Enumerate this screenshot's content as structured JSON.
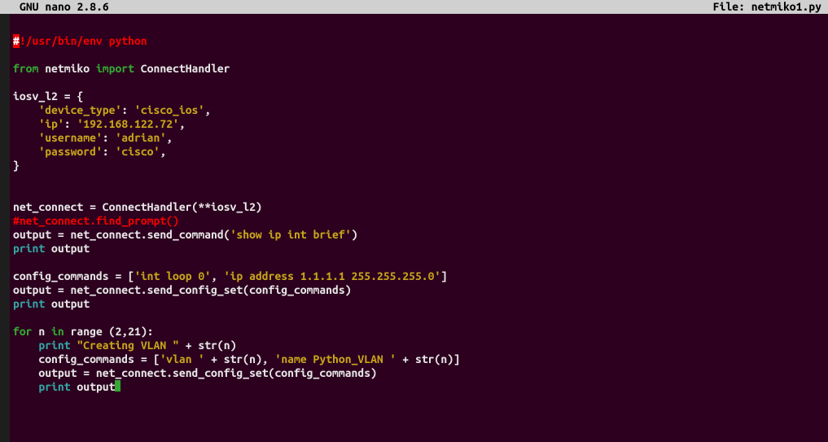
{
  "titlebar": {
    "app": "GNU nano 2.8.6",
    "file_label": "File: ",
    "filename": "netmiko1.py"
  },
  "code": {
    "shebang_hash": "#",
    "shebang_rest": "!/usr/bin/env python",
    "l_from": "from",
    "l_netmiko": " netmiko ",
    "l_import": "import",
    "l_connecthandler": " ConnectHandler",
    "var_iosv": "iosv_l2 = {",
    "k_devtype": "'device_type'",
    "v_devtype": "'cisco_ios'",
    "k_ip": "'ip'",
    "v_ip": "'192.168.122.72'",
    "k_user": "'username'",
    "v_user": "'adrian'",
    "k_pass": "'password'",
    "v_pass": "'cisco'",
    "close_brace": "}",
    "net_connect_line": "net_connect = ConnectHandler(**iosv_l2)",
    "comment_findprompt": "#net_connect.find_prompt()",
    "output_eq": "output = net_connect.send_command(",
    "str_showip": "'show ip int brief'",
    "close_paren": ")",
    "kw_print": "print",
    "sp_output": " output",
    "cfg_cmds_eq": "config_commands = [",
    "str_intloop": "'int loop 0'",
    "comma_sp": ", ",
    "str_ipaddr": "'ip address 1.1.1.1 255.255.255.0'",
    "close_bracket": "]",
    "output_sendcfg": "output = net_connect.send_config_set(config_commands)",
    "kw_for": "for",
    "for_n": " n ",
    "kw_in": "in",
    "sp_range": " range (2,21):",
    "indent": "    ",
    "str_creating": "\"Creating VLAN \"",
    "plus_strn": " + str(n)",
    "cfg_cmds_eq2": "config_commands = [",
    "str_vlan": "'vlan '",
    "plus_strn_comma": " + str(n), ",
    "str_namepv": "'name Python_VLAN '",
    "plus_strn_close": " + str(n)]",
    "output_sendcfg2": "output = net_connect.send_config_set(config_commands)"
  }
}
